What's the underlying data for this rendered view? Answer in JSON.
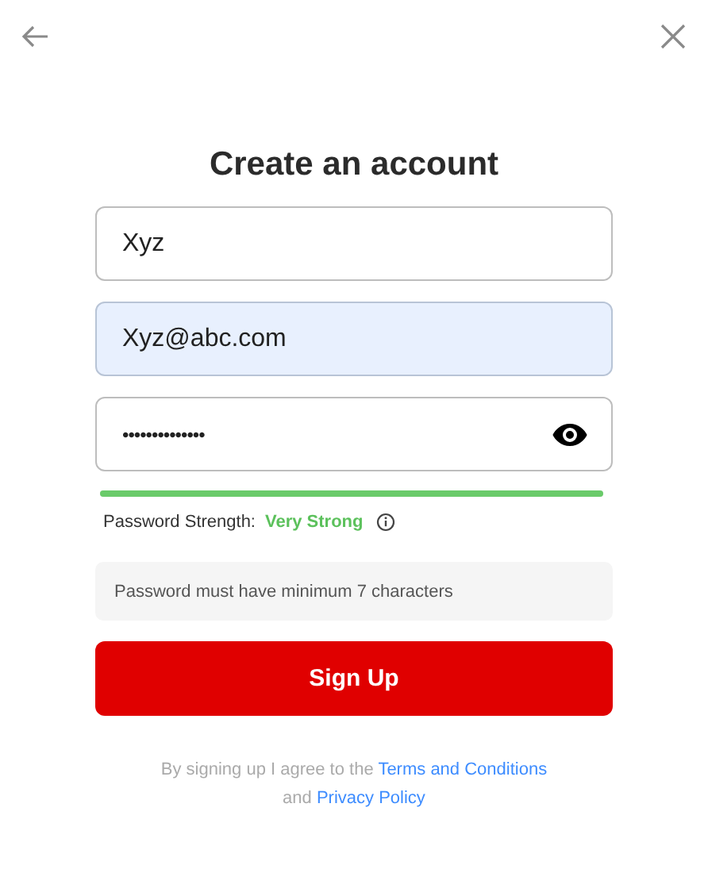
{
  "title": "Create an account",
  "fields": [
    {
      "kind": "text",
      "value": "Xyz",
      "highlighted": false
    },
    {
      "kind": "text",
      "value": "Xyz@abc.com",
      "highlighted": true
    },
    {
      "kind": "password",
      "value": "••••••••••••••",
      "highlighted": false
    }
  ],
  "strength": {
    "level": 1,
    "label": "Password Strength:",
    "value": "Very Strong"
  },
  "hint": "Password must have minimum 7 characters",
  "submit": "Sign Up",
  "legal": {
    "text": "By signing up I agree to the",
    "terms_link": "Terms and Conditions",
    "joiner": "and",
    "privacy_link": "Privacy Policy"
  }
}
